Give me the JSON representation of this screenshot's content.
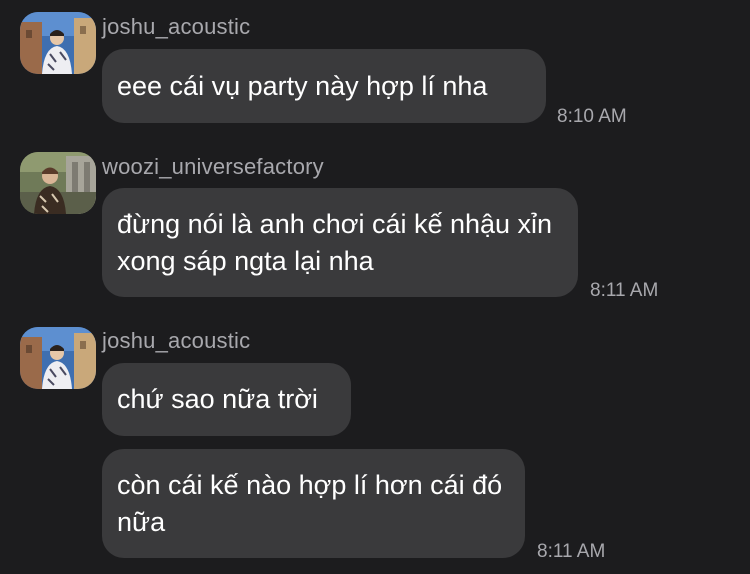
{
  "chat": {
    "groups": [
      {
        "username": "joshu_acoustic",
        "avatar_icon": "user-photo-avatar",
        "messages": [
          {
            "text": "eee cái vụ party này hợp lí nha"
          }
        ],
        "time": "8:10 AM"
      },
      {
        "username": "woozi_universefactory",
        "avatar_icon": "user-photo-avatar",
        "messages": [
          {
            "text": "đừng nói là anh chơi cái kế nhậu xỉn xong sáp ngta lại nha"
          }
        ],
        "time": "8:11 AM"
      },
      {
        "username": "joshu_acoustic",
        "avatar_icon": "user-photo-avatar",
        "messages": [
          {
            "text": "chứ sao nữa trời"
          },
          {
            "text": "còn cái kế nào hợp lí hơn cái đó nữa"
          }
        ],
        "time": "8:11 AM"
      }
    ]
  },
  "colors": {
    "background": "#1c1c1e",
    "bubble": "#3a3a3c",
    "meta_text": "#a8a8ad"
  }
}
